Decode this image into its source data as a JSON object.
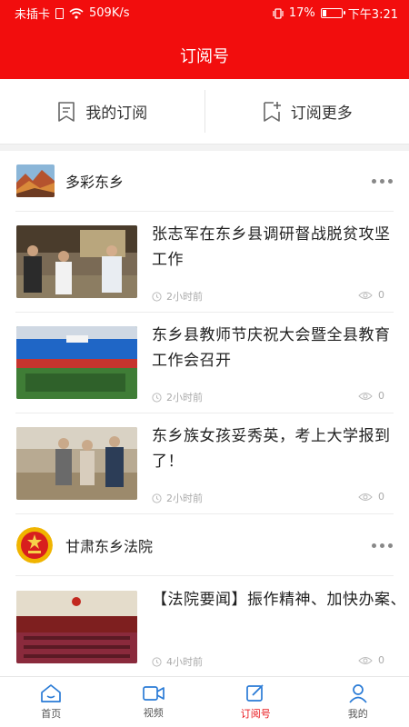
{
  "status_bar": {
    "carrier": "未插卡",
    "speed": "509K/s",
    "battery": "17%",
    "time": "下午3:21"
  },
  "header": {
    "title": "订阅号",
    "background": "#f20d0d"
  },
  "subscription_bar": {
    "my_subscriptions": "我的订阅",
    "subscribe_more": "订阅更多"
  },
  "channels": [
    {
      "name": "多彩东乡",
      "articles": [
        {
          "title": "张志军在东乡县调研督战脱贫攻坚工作",
          "time": "2小时前",
          "views": "0"
        },
        {
          "title": "东乡县教师节庆祝大会暨全县教育工作会召开",
          "time": "2小时前",
          "views": "0"
        },
        {
          "title": "东乡族女孩妥秀英，考上大学报到了！",
          "time": "2小时前",
          "views": "0"
        }
      ]
    },
    {
      "name": "甘肃东乡法院",
      "articles": [
        {
          "title": "【法院要闻】振作精神、加快办案、攻坚克难，圆满完...",
          "time": "4小时前",
          "views": "0"
        }
      ]
    }
  ],
  "bottom_nav": {
    "active_color": "#e8141a",
    "active_index": 2,
    "tabs": [
      {
        "label": "首页",
        "icon": "home-icon"
      },
      {
        "label": "视频",
        "icon": "video-icon"
      },
      {
        "label": "订阅号",
        "icon": "subscribe-icon"
      },
      {
        "label": "我的",
        "icon": "profile-icon"
      }
    ]
  }
}
